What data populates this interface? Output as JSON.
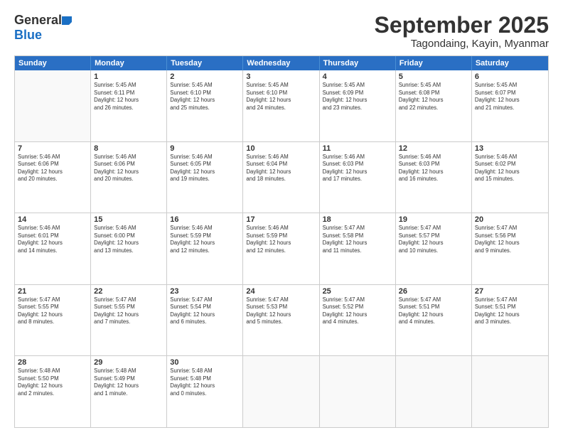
{
  "header": {
    "logo_line1": "General",
    "logo_line2": "Blue",
    "month_title": "September 2025",
    "subtitle": "Tagondaing, Kayin, Myanmar"
  },
  "days_of_week": [
    "Sunday",
    "Monday",
    "Tuesday",
    "Wednesday",
    "Thursday",
    "Friday",
    "Saturday"
  ],
  "weeks": [
    [
      {
        "day": "",
        "empty": true,
        "lines": []
      },
      {
        "day": "1",
        "lines": [
          "Sunrise: 5:45 AM",
          "Sunset: 6:11 PM",
          "Daylight: 12 hours",
          "and 26 minutes."
        ]
      },
      {
        "day": "2",
        "lines": [
          "Sunrise: 5:45 AM",
          "Sunset: 6:10 PM",
          "Daylight: 12 hours",
          "and 25 minutes."
        ]
      },
      {
        "day": "3",
        "lines": [
          "Sunrise: 5:45 AM",
          "Sunset: 6:10 PM",
          "Daylight: 12 hours",
          "and 24 minutes."
        ]
      },
      {
        "day": "4",
        "lines": [
          "Sunrise: 5:45 AM",
          "Sunset: 6:09 PM",
          "Daylight: 12 hours",
          "and 23 minutes."
        ]
      },
      {
        "day": "5",
        "lines": [
          "Sunrise: 5:45 AM",
          "Sunset: 6:08 PM",
          "Daylight: 12 hours",
          "and 22 minutes."
        ]
      },
      {
        "day": "6",
        "lines": [
          "Sunrise: 5:45 AM",
          "Sunset: 6:07 PM",
          "Daylight: 12 hours",
          "and 21 minutes."
        ]
      }
    ],
    [
      {
        "day": "7",
        "lines": [
          "Sunrise: 5:46 AM",
          "Sunset: 6:06 PM",
          "Daylight: 12 hours",
          "and 20 minutes."
        ]
      },
      {
        "day": "8",
        "lines": [
          "Sunrise: 5:46 AM",
          "Sunset: 6:06 PM",
          "Daylight: 12 hours",
          "and 20 minutes."
        ]
      },
      {
        "day": "9",
        "lines": [
          "Sunrise: 5:46 AM",
          "Sunset: 6:05 PM",
          "Daylight: 12 hours",
          "and 19 minutes."
        ]
      },
      {
        "day": "10",
        "lines": [
          "Sunrise: 5:46 AM",
          "Sunset: 6:04 PM",
          "Daylight: 12 hours",
          "and 18 minutes."
        ]
      },
      {
        "day": "11",
        "lines": [
          "Sunrise: 5:46 AM",
          "Sunset: 6:03 PM",
          "Daylight: 12 hours",
          "and 17 minutes."
        ]
      },
      {
        "day": "12",
        "lines": [
          "Sunrise: 5:46 AM",
          "Sunset: 6:03 PM",
          "Daylight: 12 hours",
          "and 16 minutes."
        ]
      },
      {
        "day": "13",
        "lines": [
          "Sunrise: 5:46 AM",
          "Sunset: 6:02 PM",
          "Daylight: 12 hours",
          "and 15 minutes."
        ]
      }
    ],
    [
      {
        "day": "14",
        "lines": [
          "Sunrise: 5:46 AM",
          "Sunset: 6:01 PM",
          "Daylight: 12 hours",
          "and 14 minutes."
        ]
      },
      {
        "day": "15",
        "lines": [
          "Sunrise: 5:46 AM",
          "Sunset: 6:00 PM",
          "Daylight: 12 hours",
          "and 13 minutes."
        ]
      },
      {
        "day": "16",
        "lines": [
          "Sunrise: 5:46 AM",
          "Sunset: 5:59 PM",
          "Daylight: 12 hours",
          "and 12 minutes."
        ]
      },
      {
        "day": "17",
        "lines": [
          "Sunrise: 5:46 AM",
          "Sunset: 5:59 PM",
          "Daylight: 12 hours",
          "and 12 minutes."
        ]
      },
      {
        "day": "18",
        "lines": [
          "Sunrise: 5:47 AM",
          "Sunset: 5:58 PM",
          "Daylight: 12 hours",
          "and 11 minutes."
        ]
      },
      {
        "day": "19",
        "lines": [
          "Sunrise: 5:47 AM",
          "Sunset: 5:57 PM",
          "Daylight: 12 hours",
          "and 10 minutes."
        ]
      },
      {
        "day": "20",
        "lines": [
          "Sunrise: 5:47 AM",
          "Sunset: 5:56 PM",
          "Daylight: 12 hours",
          "and 9 minutes."
        ]
      }
    ],
    [
      {
        "day": "21",
        "lines": [
          "Sunrise: 5:47 AM",
          "Sunset: 5:55 PM",
          "Daylight: 12 hours",
          "and 8 minutes."
        ]
      },
      {
        "day": "22",
        "lines": [
          "Sunrise: 5:47 AM",
          "Sunset: 5:55 PM",
          "Daylight: 12 hours",
          "and 7 minutes."
        ]
      },
      {
        "day": "23",
        "lines": [
          "Sunrise: 5:47 AM",
          "Sunset: 5:54 PM",
          "Daylight: 12 hours",
          "and 6 minutes."
        ]
      },
      {
        "day": "24",
        "lines": [
          "Sunrise: 5:47 AM",
          "Sunset: 5:53 PM",
          "Daylight: 12 hours",
          "and 5 minutes."
        ]
      },
      {
        "day": "25",
        "lines": [
          "Sunrise: 5:47 AM",
          "Sunset: 5:52 PM",
          "Daylight: 12 hours",
          "and 4 minutes."
        ]
      },
      {
        "day": "26",
        "lines": [
          "Sunrise: 5:47 AM",
          "Sunset: 5:51 PM",
          "Daylight: 12 hours",
          "and 4 minutes."
        ]
      },
      {
        "day": "27",
        "lines": [
          "Sunrise: 5:47 AM",
          "Sunset: 5:51 PM",
          "Daylight: 12 hours",
          "and 3 minutes."
        ]
      }
    ],
    [
      {
        "day": "28",
        "lines": [
          "Sunrise: 5:48 AM",
          "Sunset: 5:50 PM",
          "Daylight: 12 hours",
          "and 2 minutes."
        ]
      },
      {
        "day": "29",
        "lines": [
          "Sunrise: 5:48 AM",
          "Sunset: 5:49 PM",
          "Daylight: 12 hours",
          "and 1 minute."
        ]
      },
      {
        "day": "30",
        "lines": [
          "Sunrise: 5:48 AM",
          "Sunset: 5:48 PM",
          "Daylight: 12 hours",
          "and 0 minutes."
        ]
      },
      {
        "day": "",
        "empty": true,
        "lines": []
      },
      {
        "day": "",
        "empty": true,
        "lines": []
      },
      {
        "day": "",
        "empty": true,
        "lines": []
      },
      {
        "day": "",
        "empty": true,
        "lines": []
      }
    ]
  ]
}
